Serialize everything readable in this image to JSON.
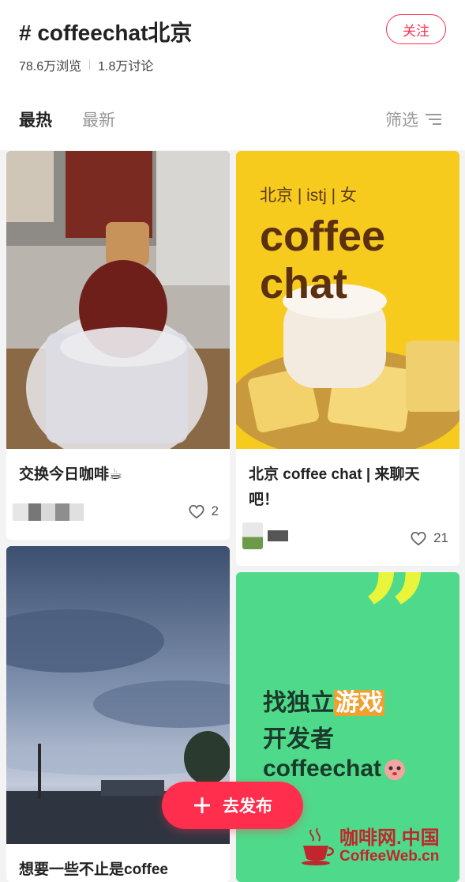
{
  "header": {
    "title": "# coffeechat北京",
    "views": "78.6万浏览",
    "discussions": "1.8万讨论",
    "follow_label": "关注"
  },
  "tabs": [
    {
      "label": "最热",
      "active": true
    },
    {
      "label": "最新",
      "active": false
    }
  ],
  "filter": {
    "label": "筛选",
    "icon": "filter-icon"
  },
  "posts": [
    {
      "caption": "交换今日咖啡☕",
      "likes": "2",
      "image": "smoked-coffee-bottle-photo"
    },
    {
      "caption": "北京 coffee chat | 来聊天吧！",
      "likes": "21",
      "image": "coffee-chat-poster",
      "poster": {
        "tagline": "北京 | istj | 女",
        "big_text_1": "coffee",
        "big_text_2": "chat"
      }
    },
    {
      "caption": "想要一些不止是coffee",
      "image": "evening-sky-photo"
    },
    {
      "image": "indie-game-poster",
      "poster": {
        "quote_mark": "”",
        "line1_prefix": "找独立",
        "line1_highlight": "游戏",
        "line2": "开发者",
        "line3": "coffeechat"
      }
    }
  ],
  "publish_button": {
    "label": "去发布",
    "icon": "plus-icon"
  },
  "watermark": {
    "cn": "咖啡网.中国",
    "en": "CoffeeWeb.cn"
  },
  "colors": {
    "accent": "#ff2e4d",
    "poster_yellow": "#f7cb1e",
    "poster_green": "#4fd98a"
  }
}
